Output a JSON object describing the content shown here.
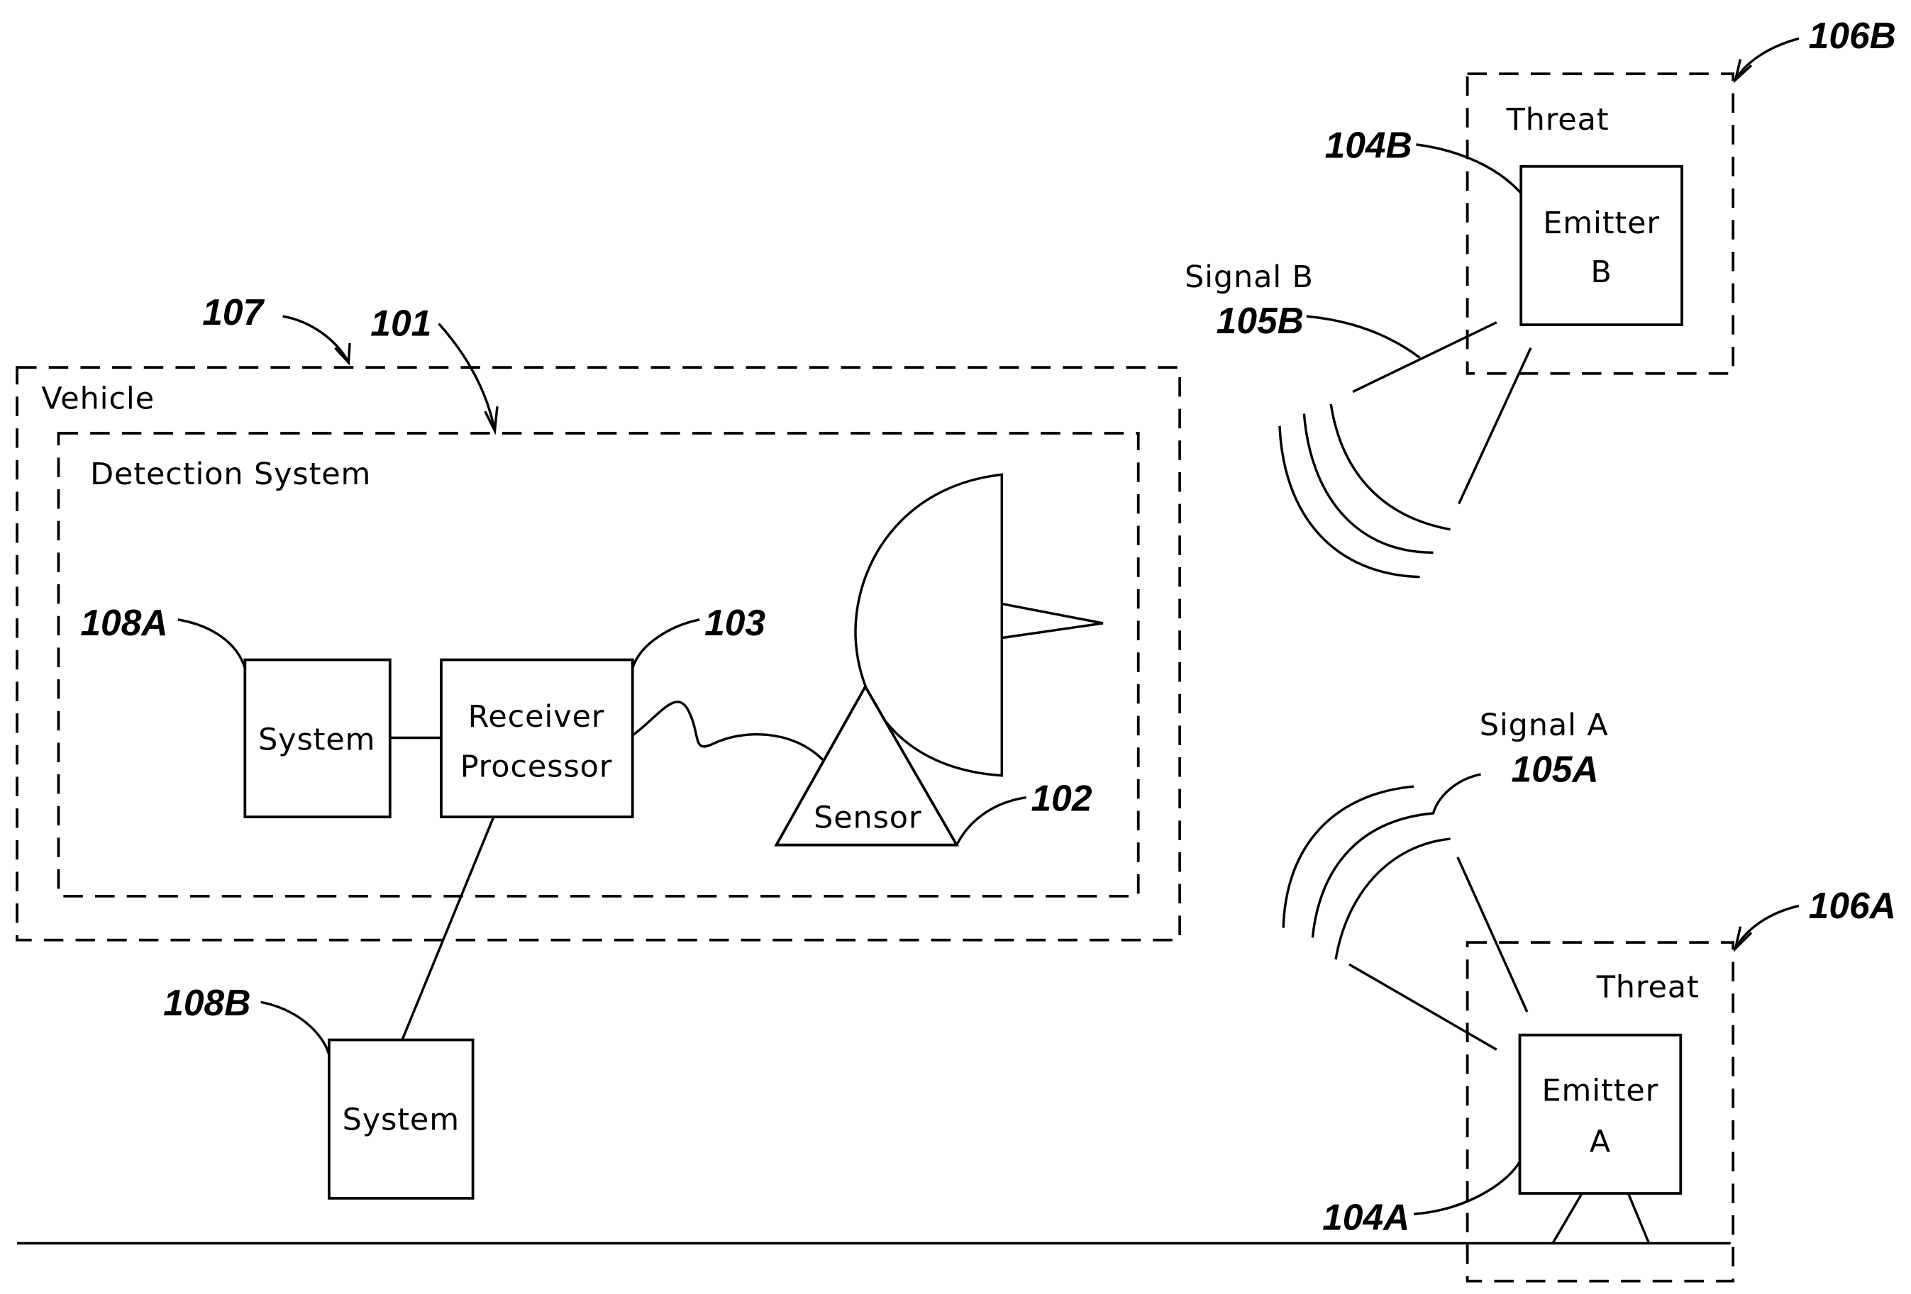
{
  "figure": {
    "vehicle": {
      "label": "Vehicle",
      "ref": "107"
    },
    "detection_system": {
      "label": "Detection System",
      "ref": "101"
    },
    "system_a": {
      "label": "System",
      "ref": "108A"
    },
    "system_b": {
      "label": "System",
      "ref": "108B"
    },
    "receiver_processor": {
      "line1": "Receiver",
      "line2": "Processor",
      "ref": "103"
    },
    "sensor": {
      "label": "Sensor",
      "ref": "102"
    },
    "threat_b": {
      "label": "Threat",
      "ref": "106B"
    },
    "emitter_b": {
      "line1": "Emitter",
      "line2": "B",
      "ref": "104B"
    },
    "signal_b": {
      "label": "Signal B",
      "ref": "105B"
    },
    "threat_a": {
      "label": "Threat",
      "ref": "106A"
    },
    "emitter_a": {
      "line1": "Emitter",
      "line2": "A",
      "ref": "104A"
    },
    "signal_a": {
      "label": "Signal A",
      "ref": "105A"
    }
  }
}
